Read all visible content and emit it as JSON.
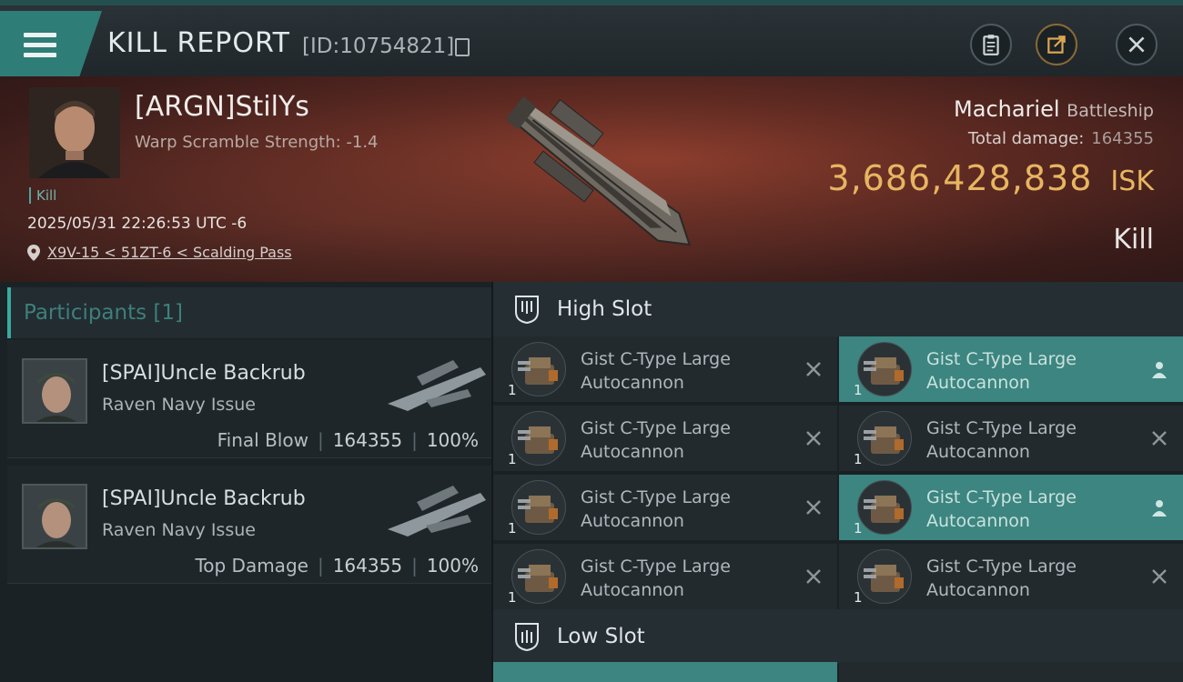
{
  "header": {
    "title": "KILL REPORT",
    "report_id": "[ID:10754821]",
    "buttons": [
      "clipboard",
      "share",
      "close"
    ]
  },
  "victim": {
    "name": "[ARGN]StilYs",
    "warp_scramble": "Warp Scramble Strength: -1.4",
    "kill_tag": "Kill",
    "datetime": "2025/05/31 22:26:53 UTC -6",
    "location": "X9V-15 < 51ZT-6 < Scalding Pass",
    "ship_name": "Machariel",
    "ship_class": "Battleship",
    "total_damage_label": "Total damage:",
    "total_damage": "164355",
    "isk_value": "3,686,428,838",
    "isk_unit": "ISK",
    "result": "Kill"
  },
  "participants": {
    "header": "Participants [1]",
    "rows": [
      {
        "name": "[SPAI]Uncle Backrub",
        "ship": "Raven Navy Issue",
        "role": "Final Blow",
        "damage": "164355",
        "percent": "100%"
      },
      {
        "name": "[SPAI]Uncle Backrub",
        "ship": "Raven Navy Issue",
        "role": "Top Damage",
        "damage": "164355",
        "percent": "100%"
      }
    ]
  },
  "high_slot": {
    "label": "High Slot",
    "items": [
      {
        "line1": "Gist C-Type Large",
        "line2": "Autocannon",
        "qty": "1",
        "status": "destroyed",
        "highlighted": false
      },
      {
        "line1": "Gist C-Type Large",
        "line2": "Autocannon",
        "qty": "1",
        "status": "dropped",
        "highlighted": true
      },
      {
        "line1": "Gist C-Type Large",
        "line2": "Autocannon",
        "qty": "1",
        "status": "destroyed",
        "highlighted": false
      },
      {
        "line1": "Gist C-Type Large",
        "line2": "Autocannon",
        "qty": "1",
        "status": "destroyed",
        "highlighted": false
      },
      {
        "line1": "Gist C-Type Large",
        "line2": "Autocannon",
        "qty": "1",
        "status": "destroyed",
        "highlighted": false
      },
      {
        "line1": "Gist C-Type Large",
        "line2": "Autocannon",
        "qty": "1",
        "status": "dropped",
        "highlighted": true
      },
      {
        "line1": "Gist C-Type Large",
        "line2": "Autocannon",
        "qty": "1",
        "status": "destroyed",
        "highlighted": false
      },
      {
        "line1": "Gist C-Type Large",
        "line2": "Autocannon",
        "qty": "1",
        "status": "destroyed",
        "highlighted": false
      }
    ]
  },
  "low_slot": {
    "label": "Low Slot"
  },
  "colors": {
    "accent": "#3c8580",
    "isk": "#e8b561",
    "hero_bg": "#5e2a22"
  }
}
